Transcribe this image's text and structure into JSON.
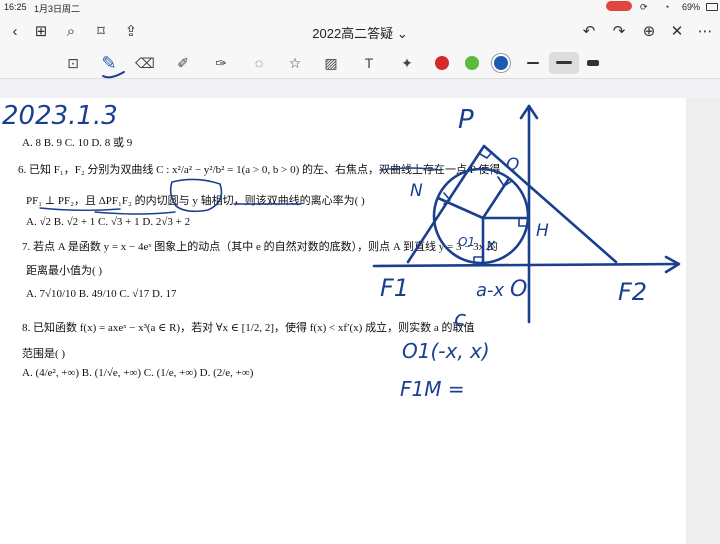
{
  "status": {
    "time": "16:25",
    "date": "1月3日周二",
    "battery": "69%"
  },
  "doc": {
    "title": "2022高二答疑",
    "title_caret": "⌄"
  },
  "colors": {
    "red": "#d42a2a",
    "green": "#5cbb3c",
    "blue": "#1d5bb0",
    "ink": "#1a3f8f"
  },
  "handwriting": {
    "date": "2023.1.3",
    "P": "P",
    "Q": "Q",
    "N": "N",
    "H": "H",
    "x": "x",
    "F1": "F1",
    "F2": "F2",
    "O": "O",
    "O1": "O1",
    "coord": "a-x",
    "c": "c",
    "o1_expr": "O1(-x, x)",
    "f1m": "F1M ="
  },
  "questions": [
    {
      "id": "q5-opts",
      "text": "A. 8                          B. 9                          C. 10                         D. 8 或 9"
    },
    {
      "id": "q6-line1",
      "text": "6.   已知 F₁，F₂ 分别为双曲线 C : x²/a² − y²/b² = 1(a > 0, b > 0) 的左、右焦点，双曲线上存在一点 P 使得"
    },
    {
      "id": "q6-line2",
      "text": "PF₁ ⊥ PF₂，且 ΔPF₁F₂ 的内切圆与 y 轴相切，则该双曲线的离心率为(    )"
    },
    {
      "id": "q6-opts",
      "text": "A.  √2                      B.  √2 + 1                C.  √3 + 1                D.  2√3 + 2"
    },
    {
      "id": "q7-line1",
      "text": "7.    若点 A 是函数 y = x − 4eˣ 图象上的动点（其中 e 的自然对数的底数），则点 A 到直线 y = 3 − 3x 的"
    },
    {
      "id": "q7-line2",
      "text": "距离最小值为(    )"
    },
    {
      "id": "q7-opts",
      "text": "A.  7√10/10                B.  49/10                  C.  √17                     D.  17"
    },
    {
      "id": "q8-line1",
      "text": "8.    已知函数 f(x) = axeˣ − x³(a ∈ R)，若对 ∀x ∈ [1/2, 2]，使得 f(x) < xf′(x) 成立，则实数 a 的取值"
    },
    {
      "id": "q8-line2",
      "text": "范围是(    )"
    },
    {
      "id": "q8-opts",
      "text": "A.  (4/e², +∞)             B.  (1/√e, +∞)            C.  (1/e, +∞)              D.  (2/e, +∞)"
    }
  ]
}
